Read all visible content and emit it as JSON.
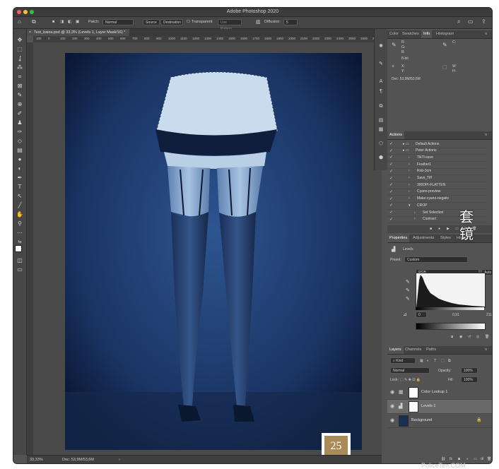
{
  "app": {
    "title": "Adobe Photoshop 2020"
  },
  "options_bar": {
    "patch_label": "Patch:",
    "patch_value": "Normal",
    "source": "Source",
    "destination": "Destination",
    "transparent": "Transparent",
    "use_pattern": "Use Pattern",
    "diffusion_label": "Diffusion:",
    "diffusion_value": "5"
  },
  "document": {
    "tab_title": "Test_baixa.psd @ 33,3% (Levels 1, Layer Mask/16) *"
  },
  "ruler": {
    "ticks": [
      "100",
      "0",
      "100",
      "200",
      "300",
      "400",
      "500",
      "600",
      "700",
      "800",
      "900",
      "1000",
      "1100",
      "1200",
      "1300",
      "1400",
      "1500",
      "1600",
      "1700",
      "1800",
      "1900",
      "2000",
      "2100",
      "2200",
      "2300",
      "2400",
      "2500",
      "2600",
      "2700"
    ]
  },
  "badge": {
    "number": "25"
  },
  "status": {
    "zoom": "33,33%",
    "doc": "Doc: 53,9M/53,6M"
  },
  "info_panel": {
    "tabs": [
      "Color",
      "Swatches",
      "Info",
      "Histogram"
    ],
    "active": "Info",
    "r": "R:",
    "g": "G:",
    "b": "B:",
    "bits": "8-bit",
    "c": "C:",
    "m": "M:",
    "y": "Y:",
    "k": "K:",
    "x": "X:",
    "yy": "Y:",
    "w": "W:",
    "h": "H:",
    "doc": "Doc: 53,9M/53,6M"
  },
  "actions_panel": {
    "title": "Actions",
    "items": [
      {
        "label": "Default Actions",
        "indent": 0
      },
      {
        "label": "Peter Actions",
        "indent": 0
      },
      {
        "label": "TikTl-save",
        "indent": 1
      },
      {
        "label": "Feather1",
        "indent": 1
      },
      {
        "label": "Rob-3cm",
        "indent": 1
      },
      {
        "label": "Save_Tiff",
        "indent": 1
      },
      {
        "label": "300DPI-FLATTEN",
        "indent": 1
      },
      {
        "label": "Cyano-preview",
        "indent": 1
      },
      {
        "label": "Make-cyano-negativ",
        "indent": 1
      },
      {
        "label": "CROP",
        "indent": 1
      },
      {
        "label": "Set Selection",
        "indent": 2
      },
      {
        "label": "Contract",
        "indent": 2
      }
    ]
  },
  "properties_panel": {
    "tabs": [
      "Properties",
      "Adjustments",
      "Styles",
      "History"
    ],
    "active": "Properties",
    "levels": "Levels",
    "preset_label": "Preset:",
    "preset_value": "Custom",
    "channel": "RGB",
    "auto": "Auto",
    "input_black": "0",
    "input_gray": "0,91",
    "input_white": "211"
  },
  "layers_panel": {
    "tabs": [
      "Layers",
      "Channels",
      "Paths"
    ],
    "active": "Layers",
    "kind": "Kind",
    "blend": "Normal",
    "opacity_label": "Opacity:",
    "opacity": "100%",
    "lock_label": "Lock:",
    "fill_label": "Fill:",
    "fill": "100%",
    "layers": [
      {
        "name": "Color Lookup 1",
        "selected": false
      },
      {
        "name": "Levels 1",
        "selected": true
      },
      {
        "name": "Background",
        "selected": false
      }
    ]
  },
  "watermark": {
    "text": "套镜"
  },
  "footer": {
    "url": "PoliceTen.COM"
  }
}
